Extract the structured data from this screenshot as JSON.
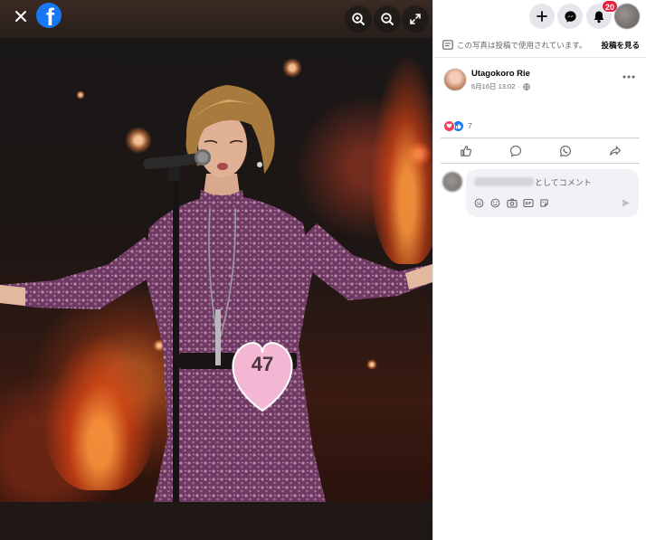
{
  "viewer": {
    "logo_letter": "f",
    "close_icon": "close-icon",
    "zoom_in_icon": "zoom-in-icon",
    "zoom_out_icon": "zoom-out-icon",
    "fullscreen_icon": "fullscreen-icon",
    "photo": {
      "subject": "singer-at-microphone",
      "contestant_number": "47"
    }
  },
  "topbar": {
    "create_icon": "plus-icon",
    "messenger_icon": "messenger-icon",
    "notifications_icon": "bell-icon",
    "notifications_count": "20",
    "account_icon": "avatar"
  },
  "notice": {
    "icon": "post-icon",
    "text": "この写真は投稿で使用されています。",
    "link_label": "投稿を見る"
  },
  "post": {
    "author": "Utagokoro Rie",
    "time": "6月16日 13:02",
    "audience_icon": "globe-icon",
    "more_icon": "more-options-icon",
    "reactions": {
      "icons": [
        "love-icon",
        "like-icon"
      ],
      "count": "7"
    },
    "actions": [
      "like-icon",
      "comment-icon",
      "whatsapp-icon",
      "share-icon"
    ]
  },
  "comment": {
    "placeholder_suffix": "としてコメント",
    "tools": [
      "avatar-sticker-icon",
      "emoji-icon",
      "camera-icon",
      "gif-icon",
      "sticker-icon"
    ],
    "send_icon": "send-icon"
  },
  "colors": {
    "facebook_blue": "#1877f2",
    "badge_red": "#e41e3f",
    "love_red": "#f33e58",
    "dress_purple": "#6e3a63",
    "bib_pink": "#f3b7d3"
  }
}
